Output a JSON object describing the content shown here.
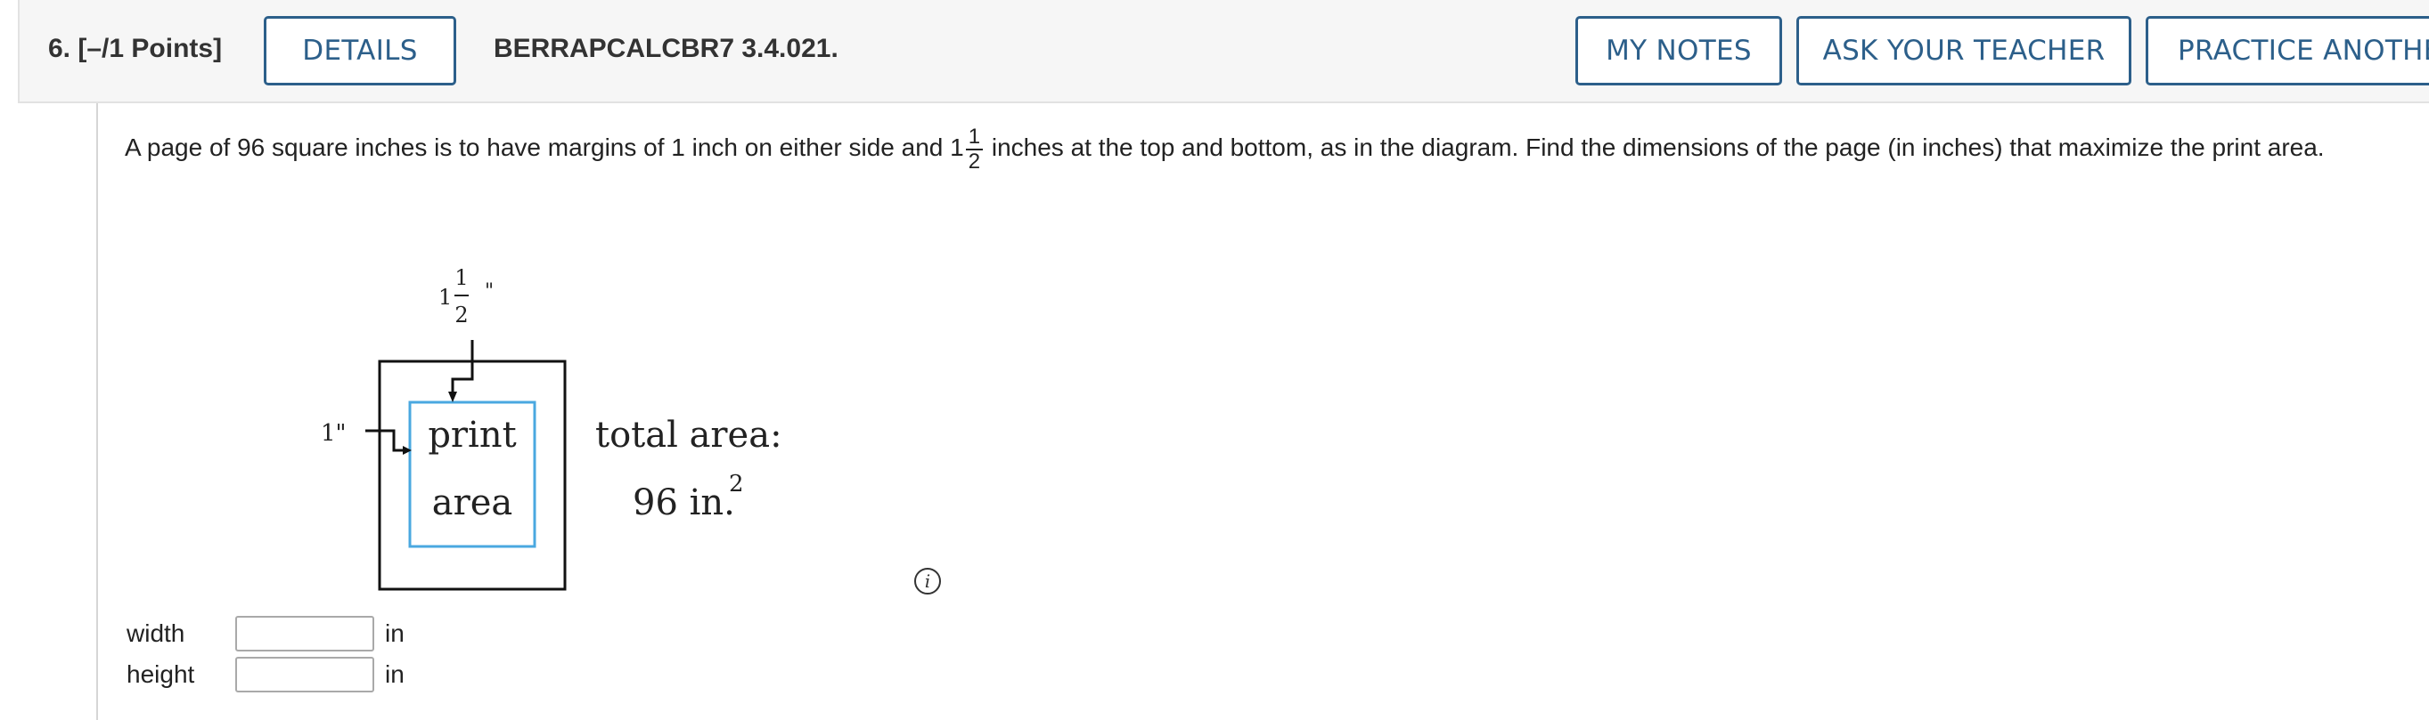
{
  "question": {
    "number_label": "6.",
    "points_label": "[–/1 Points]",
    "code": "BERRAPCALCBR7 3.4.021."
  },
  "buttons": {
    "details": "DETAILS",
    "my_notes": "MY NOTES",
    "ask_teacher": "ASK YOUR TEACHER",
    "practice": "PRACTICE ANOTHER"
  },
  "problem": {
    "text_before": "A page of 96 square inches is to have margins of 1 inch on either side and 1",
    "frac_num": "1",
    "frac_den": "2",
    "text_after": " inches at the top and bottom, as in the diagram. Find the dimensions of the page (in inches) that maximize the print area."
  },
  "diagram": {
    "top_margin_whole": "1",
    "top_margin_num": "1",
    "top_margin_den": "2",
    "top_margin_unit": "\"",
    "side_margin": "1\"",
    "print_line1": "print",
    "print_line2": "area",
    "total_label": "total area:",
    "total_value": "96 in.",
    "total_exponent": "2",
    "print_border_color": "#4aa8e0"
  },
  "answers": [
    {
      "label": "width",
      "value": "",
      "unit": "in"
    },
    {
      "label": "height",
      "value": "",
      "unit": "in"
    }
  ],
  "info_icon": "info-icon"
}
